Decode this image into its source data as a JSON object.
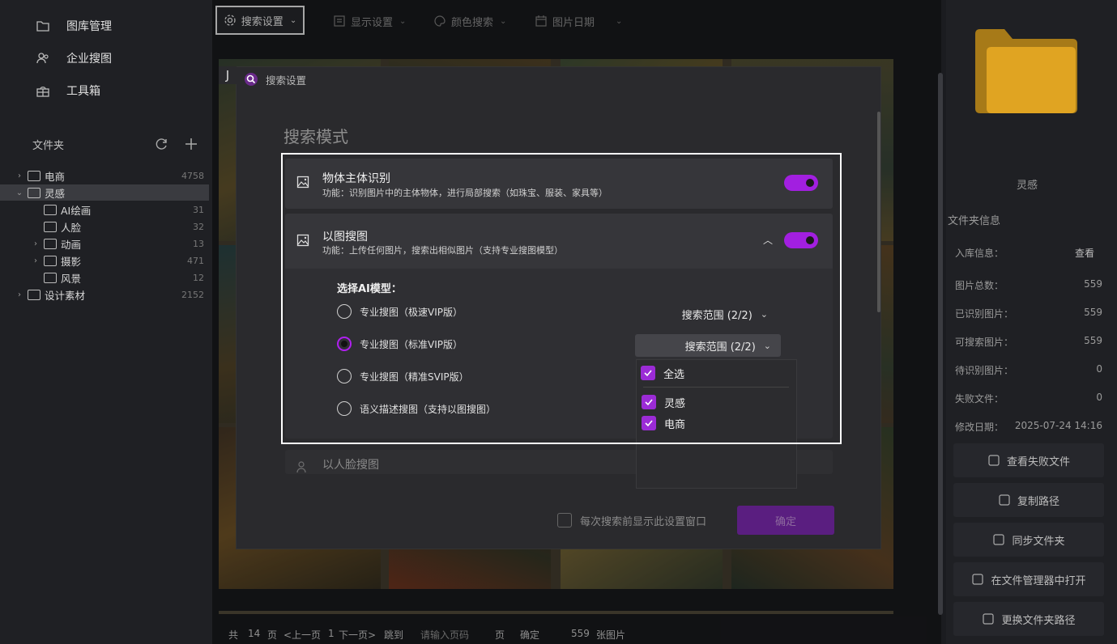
{
  "sidebar": {
    "nav": [
      {
        "label": "图库管理",
        "icon": "folder-icon"
      },
      {
        "label": "企业搜图",
        "icon": "users-icon"
      },
      {
        "label": "工具箱",
        "icon": "toolbox-icon"
      }
    ],
    "folders_label": "文件夹",
    "tree": [
      {
        "label": "电商",
        "count": "4758",
        "level": 0,
        "expandable": true,
        "expanded": false,
        "selected": false
      },
      {
        "label": "灵感",
        "count": "",
        "level": 0,
        "expandable": true,
        "expanded": true,
        "selected": true
      },
      {
        "label": "AI绘画",
        "count": "31",
        "level": 1,
        "expandable": false,
        "expanded": false,
        "selected": false
      },
      {
        "label": "人脸",
        "count": "32",
        "level": 1,
        "expandable": false,
        "expanded": false,
        "selected": false
      },
      {
        "label": "动画",
        "count": "13",
        "level": 1,
        "expandable": true,
        "expanded": false,
        "selected": false
      },
      {
        "label": "摄影",
        "count": "471",
        "level": 1,
        "expandable": true,
        "expanded": false,
        "selected": false
      },
      {
        "label": "风景",
        "count": "12",
        "level": 1,
        "expandable": false,
        "expanded": false,
        "selected": false
      },
      {
        "label": "设计素材",
        "count": "2152",
        "level": 0,
        "expandable": true,
        "expanded": false,
        "selected": false
      }
    ]
  },
  "toolbar": {
    "search_settings": "搜索设置",
    "display_settings": "显示设置",
    "color_search": "颜色搜索",
    "image_date": "图片日期"
  },
  "dialog": {
    "title": "搜索设置",
    "section_title": "搜索模式",
    "object_recognition": {
      "title": "物体主体识别",
      "desc": "功能：识别图片中的主体物体，进行局部搜索（如珠宝、服装、家具等）",
      "enabled": true
    },
    "image_search": {
      "title": "以图搜图",
      "desc": "功能：上传任何图片，搜索出相似图片（支持专业搜图模型）",
      "enabled": true,
      "model_label": "选择AI模型：",
      "models": [
        {
          "label": "专业搜图（极速VIP版）",
          "selected": false
        },
        {
          "label": "专业搜图（标准VIP版）",
          "selected": true
        },
        {
          "label": "专业搜图（精准SVIP版）",
          "selected": false
        },
        {
          "label": "语义描述搜图（支持以图搜图）",
          "selected": false
        }
      ],
      "scope_label": "搜索范围 (2/2)",
      "scope_options": {
        "select_all": "全选",
        "items": [
          "灵感",
          "电商"
        ]
      }
    },
    "face_search": {
      "title": "以人脸搜图"
    },
    "show_before_search": "每次搜索前显示此设置窗口",
    "confirm": "确定"
  },
  "pager": {
    "total_prefix": "共",
    "total_pages": "14",
    "page_word": "页",
    "prev": "<上一页",
    "current": "1",
    "next": "下一页>",
    "jump": "跳到",
    "input_placeholder": "请输入页码",
    "page_suffix": "页",
    "go": "确定",
    "image_count": "559",
    "image_unit": "张图片"
  },
  "right_panel": {
    "folder_name": "灵感",
    "info_title": "文件夹信息",
    "rows": [
      {
        "label": "入库信息：",
        "value": "查看"
      },
      {
        "label": "图片总数：",
        "value": "559"
      },
      {
        "label": "已识别图片：",
        "value": "559"
      },
      {
        "label": "可搜索图片：",
        "value": "559"
      },
      {
        "label": "待识别图片：",
        "value": "0"
      },
      {
        "label": "失败文件：",
        "value": "0"
      },
      {
        "label": "修改日期：",
        "value": "2025-07-24 14:16"
      }
    ],
    "buttons": [
      "查看失败文件",
      "复制路径",
      "同步文件夹",
      "在文件管理器中打开",
      "更换文件夹路径"
    ]
  },
  "colors": {
    "accent": "#a21fe0",
    "folder": "#e0a422",
    "background": "#1b1c20"
  }
}
